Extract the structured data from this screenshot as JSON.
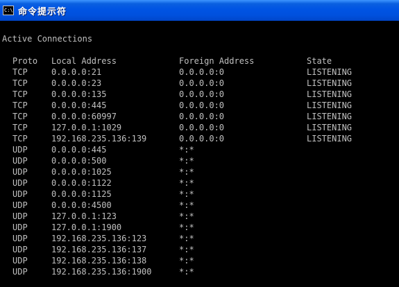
{
  "window": {
    "title": "命令提示符",
    "icon_text": "C:\\"
  },
  "console": {
    "heading": "Active Connections",
    "headers": {
      "proto": "Proto",
      "local": "Local Address",
      "foreign": "Foreign Address",
      "state": "State"
    },
    "rows": [
      {
        "proto": "TCP",
        "local": "0.0.0.0:21",
        "foreign": "0.0.0.0:0",
        "state": "LISTENING"
      },
      {
        "proto": "TCP",
        "local": "0.0.0.0:23",
        "foreign": "0.0.0.0:0",
        "state": "LISTENING"
      },
      {
        "proto": "TCP",
        "local": "0.0.0.0:135",
        "foreign": "0.0.0.0:0",
        "state": "LISTENING"
      },
      {
        "proto": "TCP",
        "local": "0.0.0.0:445",
        "foreign": "0.0.0.0:0",
        "state": "LISTENING"
      },
      {
        "proto": "TCP",
        "local": "0.0.0.0:60997",
        "foreign": "0.0.0.0:0",
        "state": "LISTENING"
      },
      {
        "proto": "TCP",
        "local": "127.0.0.1:1029",
        "foreign": "0.0.0.0:0",
        "state": "LISTENING"
      },
      {
        "proto": "TCP",
        "local": "192.168.235.136:139",
        "foreign": "0.0.0.0:0",
        "state": "LISTENING"
      },
      {
        "proto": "UDP",
        "local": "0.0.0.0:445",
        "foreign": "*:*",
        "state": ""
      },
      {
        "proto": "UDP",
        "local": "0.0.0.0:500",
        "foreign": "*:*",
        "state": ""
      },
      {
        "proto": "UDP",
        "local": "0.0.0.0:1025",
        "foreign": "*:*",
        "state": ""
      },
      {
        "proto": "UDP",
        "local": "0.0.0.0:1122",
        "foreign": "*:*",
        "state": ""
      },
      {
        "proto": "UDP",
        "local": "0.0.0.0:1125",
        "foreign": "*:*",
        "state": ""
      },
      {
        "proto": "UDP",
        "local": "0.0.0.0:4500",
        "foreign": "*:*",
        "state": ""
      },
      {
        "proto": "UDP",
        "local": "127.0.0.1:123",
        "foreign": "*:*",
        "state": ""
      },
      {
        "proto": "UDP",
        "local": "127.0.0.1:1900",
        "foreign": "*:*",
        "state": ""
      },
      {
        "proto": "UDP",
        "local": "192.168.235.136:123",
        "foreign": "*:*",
        "state": ""
      },
      {
        "proto": "UDP",
        "local": "192.168.235.136:137",
        "foreign": "*:*",
        "state": ""
      },
      {
        "proto": "UDP",
        "local": "192.168.235.136:138",
        "foreign": "*:*",
        "state": ""
      },
      {
        "proto": "UDP",
        "local": "192.168.235.136:1900",
        "foreign": "*:*",
        "state": ""
      }
    ]
  },
  "colors": {
    "titlebar": "#0054e3",
    "console_bg": "#000000",
    "console_text": "#c0c0c0"
  }
}
